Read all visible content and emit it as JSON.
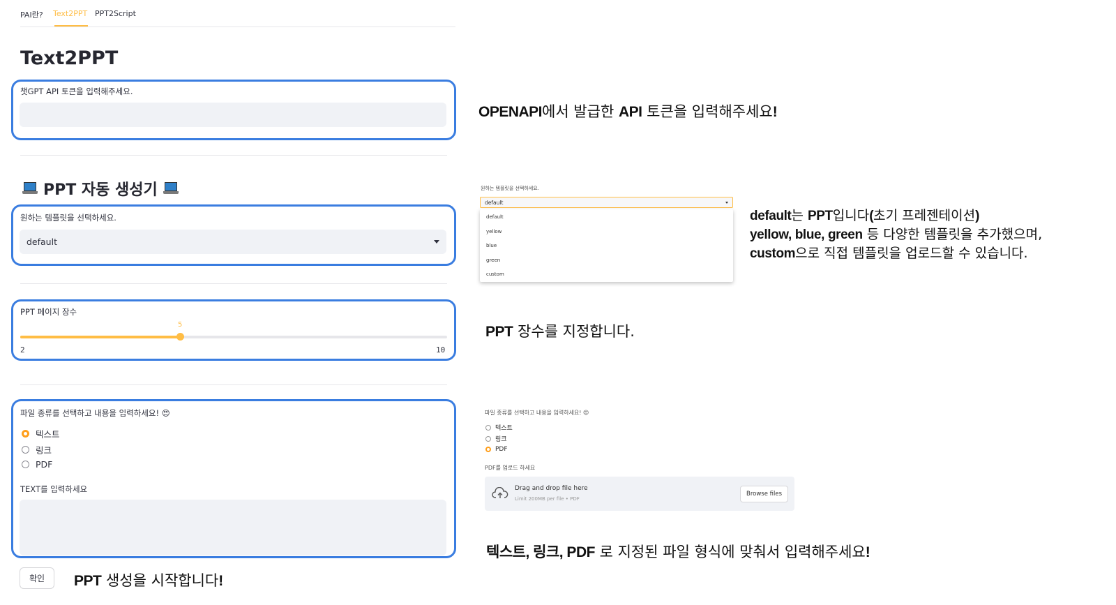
{
  "tabs": [
    {
      "label": "PAI란?",
      "active": false
    },
    {
      "label": "Text2PPT",
      "active": true
    },
    {
      "label": "PPT2Script",
      "active": false
    }
  ],
  "page": {
    "title": "Text2PPT",
    "subheader": "PPT 자동 생성기"
  },
  "api_token": {
    "label": "챗GPT API 토큰을 입력해주세요.",
    "value": ""
  },
  "template": {
    "label": "원하는 템플릿을 선택하세요.",
    "selected": "default"
  },
  "pages": {
    "label": "PPT 페이지 장수",
    "value": "5",
    "min": "2",
    "max": "10",
    "fraction": 0.375
  },
  "file_type": {
    "label": "파일 종류를 선택하고 내용을 입력하세요! 😍",
    "options": [
      "텍스트",
      "링크",
      "PDF"
    ],
    "selected_index": 0,
    "text_label": "TEXT를 입력하세요"
  },
  "submit": {
    "label": "확인"
  },
  "annotations": {
    "token_bold_1": "OPENAPI",
    "token_text_1": "에서 발급한 ",
    "token_bold_2": "API",
    "token_text_2": " 토큰을 입력해주세요",
    "token_bold_3": "!",
    "template_l1_bold_1": "default",
    "template_l1_text_1": "는 ",
    "template_l1_bold_2": "PPT",
    "template_l1_text_2": "입니다",
    "template_l1_bold_3": "(",
    "template_l1_text_3": "초기 프레젠테이션",
    "template_l1_bold_4": ")",
    "template_l2_bold": "yellow, blue, green",
    "template_l2_text": " 등 다양한 템플릿을 추가했으며,",
    "template_l3_bold": "custom",
    "template_l3_text": "으로 직접 템플릿을 업로드할 수 있습니다.",
    "pages_bold": "PPT",
    "pages_text": " 장수를 지정합니다.",
    "file_bold_1": "텍스트, 링크, PDF",
    "file_text_1": " 로 지정된 파일 형식에 맞춰서 입력해주세요",
    "file_bold_2": "!",
    "submit_bold_1": "PPT",
    "submit_text_1": " 생성을 시작합니다",
    "submit_bold_2": "!"
  },
  "dropdown_preview": {
    "label": "원하는 템플릿을 선택하세요.",
    "value": "default",
    "options": [
      "default",
      "yellow",
      "blue",
      "green",
      "custom"
    ]
  },
  "radio_preview": {
    "label": "파일 종류를 선택하고 내용을 입력하세요! 😍",
    "options": [
      "텍스트",
      "링크",
      "PDF"
    ],
    "selected_index": 2,
    "upload_label": "PDF를 업로드 하세요",
    "drop_text": "Drag and drop file here",
    "limit_text": "Limit 200MB per file • PDF",
    "browse_label": "Browse files"
  },
  "colors": {
    "accent": "#ffbd45",
    "highlight_border": "#3a7de0",
    "input_bg": "#f0f2f6",
    "text": "#31333f"
  }
}
